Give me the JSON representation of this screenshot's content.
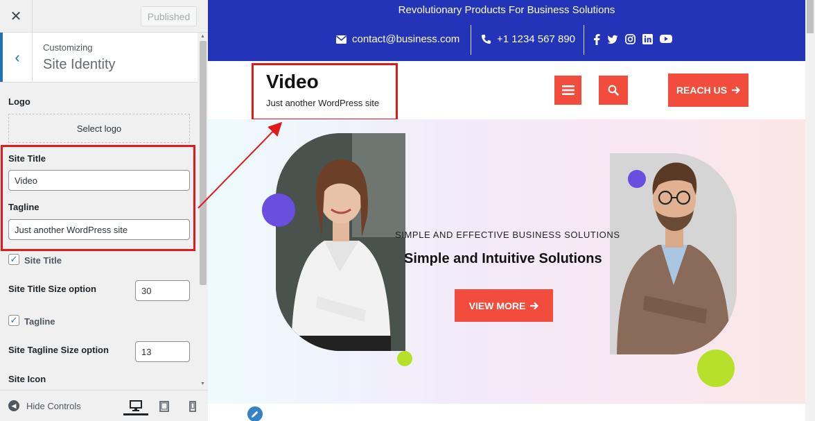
{
  "header": {
    "published_label": "Published"
  },
  "panel": {
    "breadcrumb": "Customizing",
    "section_title": "Site Identity"
  },
  "fields": {
    "logo_label": "Logo",
    "select_logo_label": "Select logo",
    "site_title_label": "Site Title",
    "site_title_value": "Video",
    "tagline_label": "Tagline",
    "tagline_value": "Just another WordPress site",
    "show_site_title_label": "Site Title",
    "show_site_title_checked": true,
    "site_title_size_label": "Site Title Size option",
    "site_title_size_value": "30",
    "show_tagline_label": "Tagline",
    "show_tagline_checked": true,
    "site_tagline_size_label": "Site Tagline Size option",
    "site_tagline_size_value": "13",
    "site_icon_label": "Site Icon"
  },
  "footer": {
    "hide_controls_label": "Hide Controls"
  },
  "preview": {
    "topbar_title": "Revolutionary Products For Business Solutions",
    "email": "contact@business.com",
    "phone": "+1 1234 567 890",
    "site_title": "Video",
    "tagline": "Just another WordPress site",
    "reach_us_label": "REACH US",
    "hero_subtitle": "SIMPLE AND EFFECTIVE BUSINESS SOLUTIONS",
    "hero_title": "Simple and Intuitive Solutions",
    "view_more_label": "VIEW MORE"
  },
  "colors": {
    "topbar": "#2434b9",
    "accent": "#f24c3d",
    "highlight": "#e01a1a",
    "wp_blue": "#2271b1",
    "purple_dot": "#6a4ee0",
    "lime_dot": "#b6e02a"
  },
  "icons": [
    "close-icon",
    "chevron-left-icon",
    "envelope-icon",
    "phone-icon",
    "facebook-icon",
    "twitter-icon",
    "instagram-icon",
    "linkedin-icon",
    "youtube-icon",
    "hamburger-icon",
    "search-icon",
    "arrow-right-icon",
    "pencil-icon",
    "desktop-icon",
    "tablet-icon",
    "mobile-icon",
    "check-icon"
  ]
}
